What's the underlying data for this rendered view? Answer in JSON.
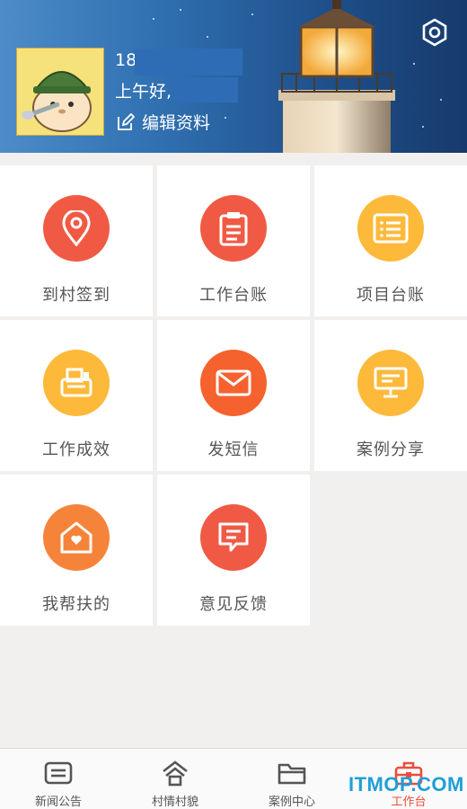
{
  "user": {
    "id": "18",
    "greeting": "上午好,",
    "edit_label": "编辑资料"
  },
  "grid": [
    {
      "label": "到村签到",
      "icon": "location-pin-icon",
      "color": "#f05a44"
    },
    {
      "label": "工作台账",
      "icon": "clipboard-icon",
      "color": "#f05a44"
    },
    {
      "label": "项目台账",
      "icon": "list-icon",
      "color": "#fdb93a"
    },
    {
      "label": "工作成效",
      "icon": "printer-icon",
      "color": "#fdb93a"
    },
    {
      "label": "发短信",
      "icon": "envelope-icon",
      "color": "#f5622e"
    },
    {
      "label": "案例分享",
      "icon": "presentation-board-icon",
      "color": "#fdb93a"
    },
    {
      "label": "我帮扶的",
      "icon": "home-heart-icon",
      "color": "#f5843a"
    },
    {
      "label": "意见反馈",
      "icon": "feedback-message-icon",
      "color": "#f05a44"
    }
  ],
  "tabs": [
    {
      "label": "新闻公告",
      "icon": "news-icon",
      "active": false
    },
    {
      "label": "村情村貌",
      "icon": "village-icon",
      "active": false
    },
    {
      "label": "案例中心",
      "icon": "folder-icon",
      "active": false
    },
    {
      "label": "工作台",
      "icon": "toolbox-icon",
      "active": true
    }
  ],
  "watermark": "ITMOP.COM",
  "colors": {
    "active_tab": "#e94e3c",
    "header_blue": "#2f6fb0"
  }
}
